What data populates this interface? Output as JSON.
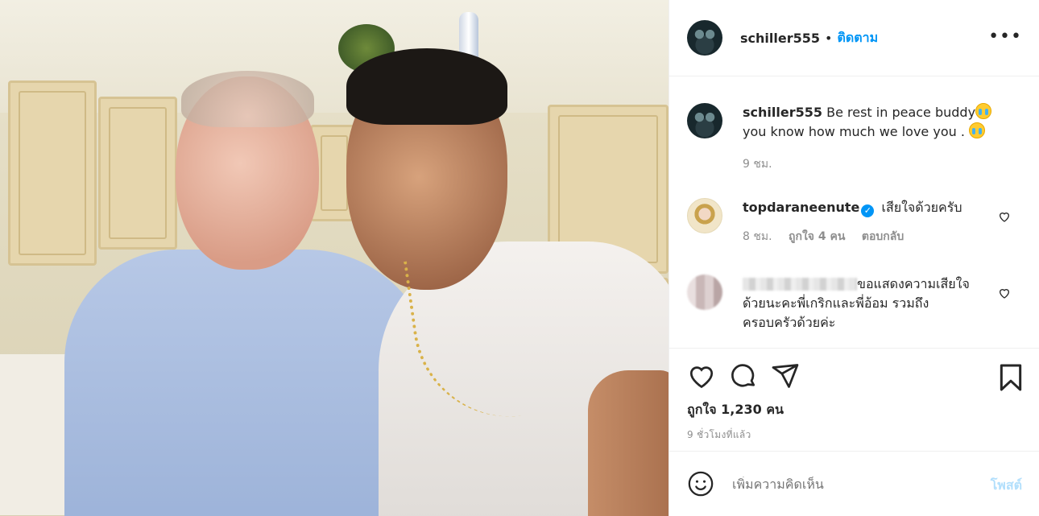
{
  "header": {
    "username": "schiller555",
    "separator": "•",
    "follow_label": "ติดตาม",
    "more_label": "•••"
  },
  "caption": {
    "username": "schiller555",
    "text_line1": "Be rest in peace buddy",
    "text_line2": "you know how much we love you .",
    "time": "9 ชม."
  },
  "comments": [
    {
      "username": "topdaraneenute",
      "text": "เสียใจด้วยครับ",
      "time": "8 ชม.",
      "likes": "ถูกใจ 4 คน",
      "reply": "ตอบกลับ"
    },
    {
      "text_line1": "ขอแสดงความเสียใจ",
      "text_line2": "ด้วยนะคะพี่เกริกและพี่อ้อม รวมถึง",
      "text_line3": "ครอบครัวด้วยค่ะ"
    }
  ],
  "actions": {
    "likes_count": "ถูกใจ 1,230 คน",
    "posted_ago": "9 ชั่วโมงที่แล้ว"
  },
  "add_comment": {
    "placeholder": "เพิ่มความคิดเห็น",
    "post_label": "โพสต์"
  },
  "colors": {
    "accent": "#0095f6",
    "post_disabled": "#b2dffc",
    "muted": "#8e8e8e"
  }
}
